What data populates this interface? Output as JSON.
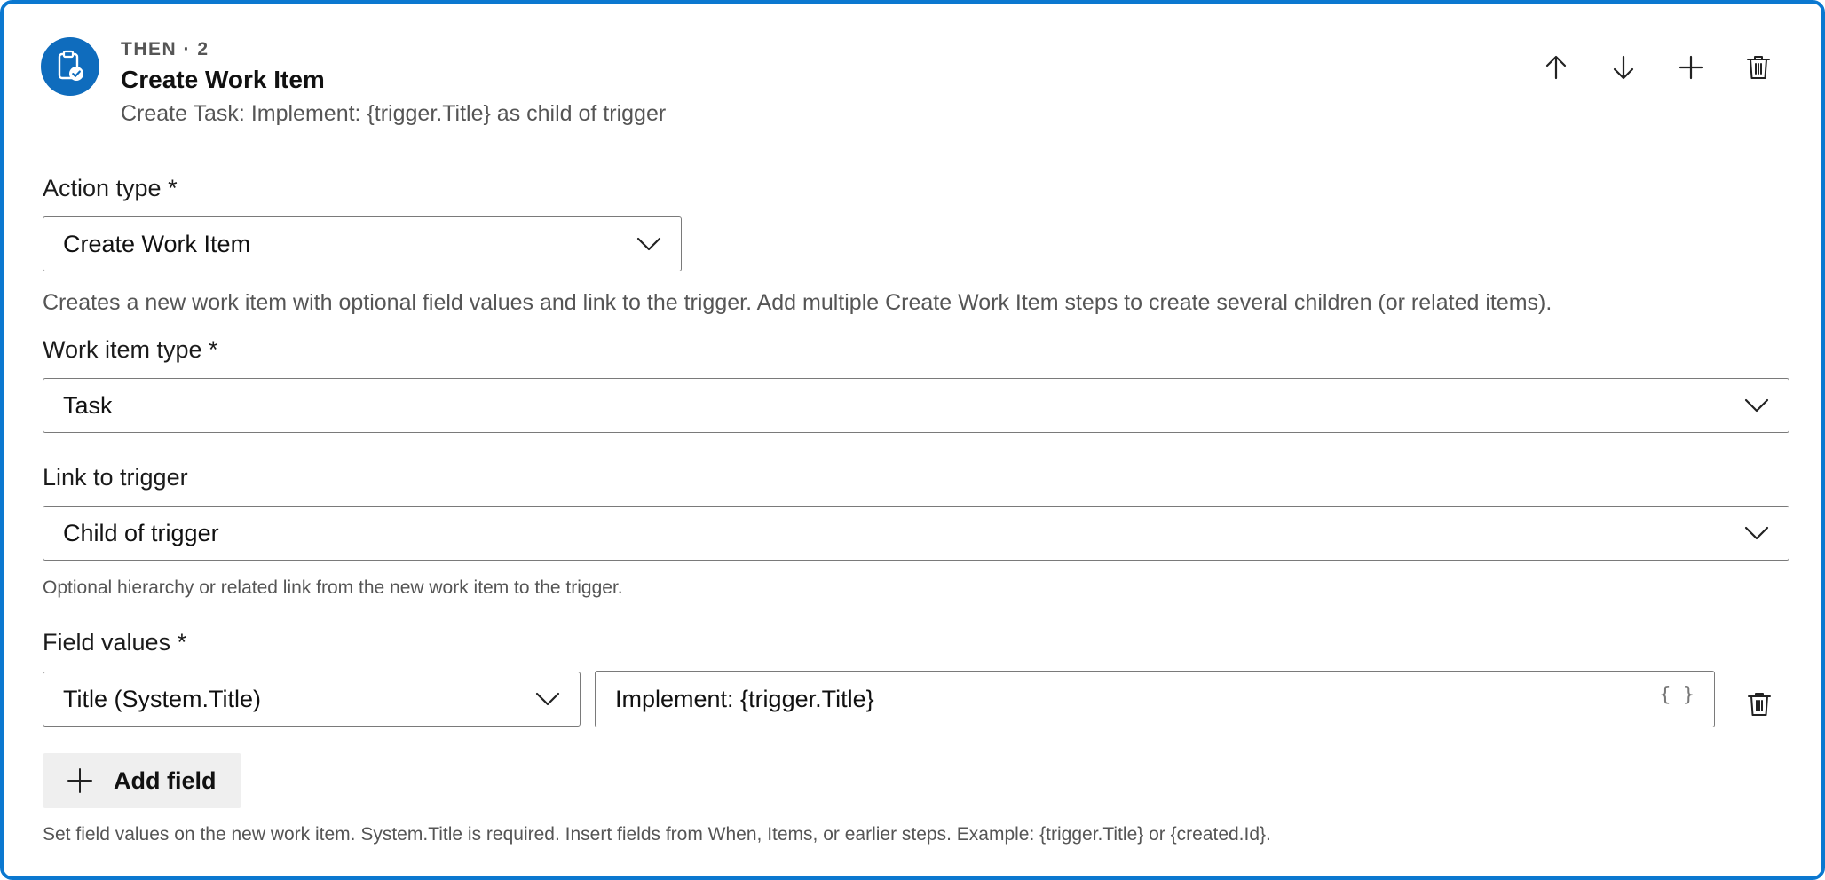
{
  "step": {
    "label": "THEN · 2",
    "title": "Create Work Item",
    "summary": "Create Task: Implement: {trigger.Title} as child of trigger",
    "icon": "clipboard-check-icon",
    "accent_color": "#0f6cbd",
    "border_color": "#0b78d0"
  },
  "toolbar": {
    "move_up": "arrow-up-icon",
    "move_down": "arrow-down-icon",
    "add": "plus-icon",
    "delete": "trash-icon"
  },
  "action_type": {
    "label": "Action type *",
    "value": "Create Work Item",
    "help": "Creates a new work item with optional field values and link to the trigger. Add multiple Create Work Item steps to create several children (or related items)."
  },
  "work_item_type": {
    "label": "Work item type *",
    "value": "Task"
  },
  "link_to_trigger": {
    "label": "Link to trigger",
    "value": "Child of trigger",
    "help": "Optional hierarchy or related link from the new work item to the trigger."
  },
  "field_values": {
    "label": "Field values *",
    "rows": [
      {
        "field": "Title (System.Title)",
        "value": "Implement: {trigger.Title}",
        "insert_token": "{ }"
      }
    ],
    "add_label": "Add field",
    "help": "Set field values on the new work item. System.Title is required. Insert fields from When, Items, or earlier steps. Example: {trigger.Title} or {created.Id}."
  }
}
